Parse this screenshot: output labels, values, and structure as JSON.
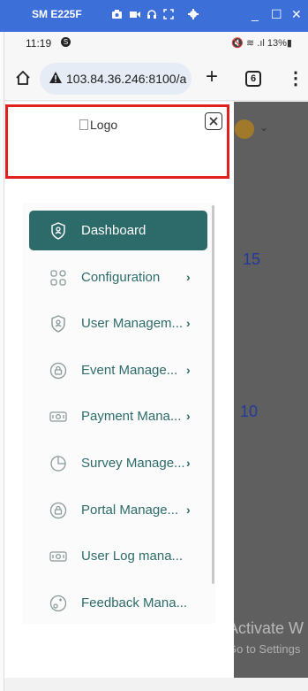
{
  "window": {
    "title": "SM E225F",
    "controls": {
      "minimize": "_",
      "maximize": "☐",
      "close": "✕"
    }
  },
  "status_bar": {
    "time": "11:19",
    "notification_badge": "S",
    "right_icons": "🔇 ≋ .ıl 13%▮"
  },
  "browser": {
    "url": "103.84.36.246:8100/a",
    "tab_count": "6",
    "new_tab": "+",
    "menu": "⋮"
  },
  "drawer": {
    "logo_alt": "Logo",
    "menu_items": [
      {
        "label": "Dashboard",
        "icon": "shield-user-icon",
        "active": true,
        "chevron": ""
      },
      {
        "label": "Configuration",
        "icon": "grid-config-icon",
        "active": false,
        "chevron": "›"
      },
      {
        "label": "User Managem...",
        "icon": "shield-user-icon",
        "active": false,
        "chevron": "›"
      },
      {
        "label": "Event Manage...",
        "icon": "lock-circle-icon",
        "active": false,
        "chevron": "›"
      },
      {
        "label": "Payment Mana...",
        "icon": "money-icon",
        "active": false,
        "chevron": "›"
      },
      {
        "label": "Survey Manage...",
        "icon": "pie-chart-icon",
        "active": false,
        "chevron": "›"
      },
      {
        "label": "Portal Manage...",
        "icon": "lock-circle-icon",
        "active": false,
        "chevron": "›"
      },
      {
        "label": "User Log mana...",
        "icon": "money-icon",
        "active": false,
        "chevron": ""
      },
      {
        "label": "Feedback Mana...",
        "icon": "feedback-icon",
        "active": false,
        "chevron": ""
      }
    ]
  },
  "background": {
    "stat_values": [
      "15",
      "10"
    ],
    "watermark_line1": "Activate W",
    "watermark_line2": "Go to Settings"
  },
  "colors": {
    "accent": "#2d6b6a",
    "window_bar": "#3c6fd8",
    "highlight_border": "#e0201e",
    "overlay": "#5f5f5f"
  }
}
